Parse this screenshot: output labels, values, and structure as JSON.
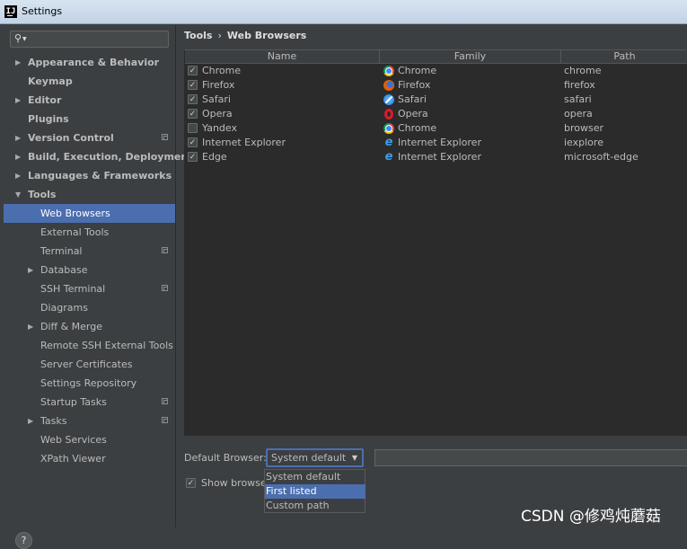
{
  "window": {
    "title": "Settings",
    "app_icon": "intellij-icon"
  },
  "search": {
    "placeholder": ""
  },
  "sidebar": {
    "items": [
      {
        "label": "Appearance & Behavior",
        "arrow": "▶"
      },
      {
        "label": "Keymap"
      },
      {
        "label": "Editor",
        "arrow": "▶"
      },
      {
        "label": "Plugins"
      },
      {
        "label": "Version Control",
        "arrow": "▶"
      },
      {
        "label": "Build, Execution, Deployment",
        "arrow": "▶"
      },
      {
        "label": "Languages & Frameworks",
        "arrow": "▶"
      },
      {
        "label": "Tools",
        "arrow": "▼"
      },
      {
        "label": "Web Browsers"
      },
      {
        "label": "External Tools"
      },
      {
        "label": "Terminal"
      },
      {
        "label": "Database",
        "arrow": "▶"
      },
      {
        "label": "SSH Terminal"
      },
      {
        "label": "Diagrams"
      },
      {
        "label": "Diff & Merge",
        "arrow": "▶"
      },
      {
        "label": "Remote SSH External Tools"
      },
      {
        "label": "Server Certificates"
      },
      {
        "label": "Settings Repository"
      },
      {
        "label": "Startup Tasks"
      },
      {
        "label": "Tasks",
        "arrow": "▶"
      },
      {
        "label": "Web Services"
      },
      {
        "label": "XPath Viewer"
      }
    ],
    "selected": "Web Browsers"
  },
  "breadcrumb": {
    "parent": "Tools",
    "separator": "›",
    "current": "Web Browsers"
  },
  "table": {
    "columns": [
      "Name",
      "Family",
      "Path"
    ],
    "rows": [
      {
        "checked": true,
        "name": "Chrome",
        "family": "Chrome",
        "icon": "chrome-icon",
        "path": "chrome"
      },
      {
        "checked": true,
        "name": "Firefox",
        "family": "Firefox",
        "icon": "firefox-icon",
        "path": "firefox"
      },
      {
        "checked": true,
        "name": "Safari",
        "family": "Safari",
        "icon": "safari-icon",
        "path": "safari"
      },
      {
        "checked": true,
        "name": "Opera",
        "family": "Opera",
        "icon": "opera-icon",
        "path": "opera"
      },
      {
        "checked": false,
        "name": "Yandex",
        "family": "Chrome",
        "icon": "chrome-icon",
        "path": "browser"
      },
      {
        "checked": true,
        "name": "Internet Explorer",
        "family": "Internet Explorer",
        "icon": "ie-icon",
        "path": "iexplore"
      },
      {
        "checked": true,
        "name": "Edge",
        "family": "Internet Explorer",
        "icon": "ie-icon",
        "path": "microsoft-edge"
      }
    ]
  },
  "default_browser": {
    "label": "Default Browser:",
    "selected": "System default",
    "options": [
      "System default",
      "First listed",
      "Custom path"
    ],
    "highlighted": "First listed",
    "path_value": ""
  },
  "show_browser": {
    "label": "Show browser",
    "checked": true
  },
  "help": {
    "label": "?"
  },
  "watermark": {
    "text": "CSDN @修鸡炖蘑菇"
  },
  "colors": {
    "selection": "#4b6eaf",
    "panel": "#3c3f41",
    "table_bg": "#2b2b2b",
    "text": "#bbbbbb"
  }
}
